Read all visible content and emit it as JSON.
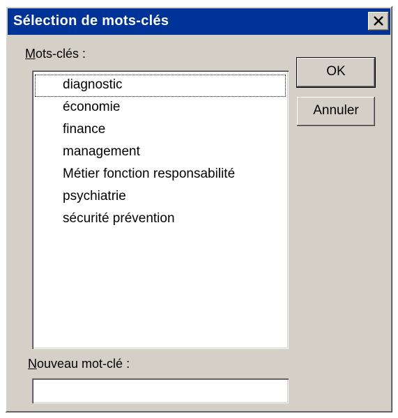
{
  "window": {
    "title": "Sélection de mots-clés",
    "close_icon": "close-icon"
  },
  "keywords": {
    "label": "Mots-clés :",
    "items": [
      "diagnostic",
      "économie",
      "finance",
      "management",
      "Métier fonction responsabilité",
      "psychiatrie",
      "sécurité prévention"
    ],
    "focused_item": "diagnostic"
  },
  "buttons": {
    "ok_label": "OK",
    "cancel_label": "Annuler"
  },
  "new_keyword": {
    "label": "Nouveau mot-clé :",
    "value": "",
    "placeholder": ""
  },
  "colors": {
    "titlebar": "#003398",
    "dialog_face": "#d4d0c8"
  }
}
